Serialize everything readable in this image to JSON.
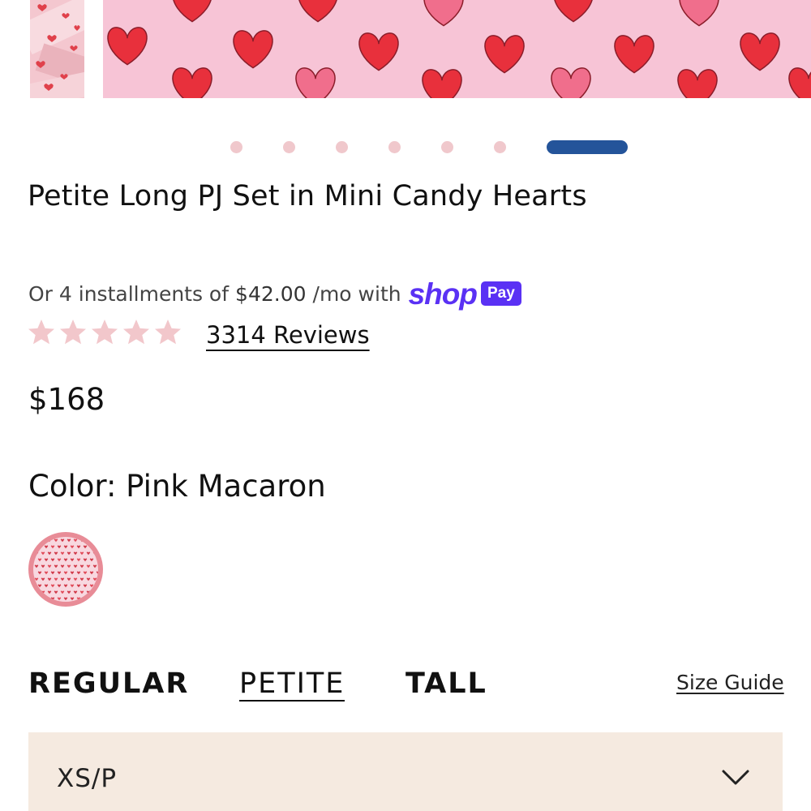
{
  "product": {
    "title": "Petite Long PJ Set in Mini Candy Hearts",
    "price": "$168"
  },
  "carousel": {
    "dot_count": 7,
    "active_index": 6
  },
  "financing": {
    "prefix": "Or 4 installments of",
    "amount": "$42.00",
    "suffix": "/mo with",
    "brand_word": "shop",
    "brand_badge": "Pay",
    "brand_color": "#5a31f4"
  },
  "rating": {
    "stars": 5,
    "star_color": "#f2c7cb",
    "reviews_label": "3314 Reviews"
  },
  "color": {
    "label": "Color: Pink Macaron",
    "swatch_icon": "pink-hearts-swatch"
  },
  "fit_tabs": {
    "items": [
      "REGULAR",
      "PETITE",
      "TALL"
    ],
    "selected": "PETITE",
    "size_guide_label": "Size Guide"
  },
  "size": {
    "selected_value": "XS/P",
    "icon": "chevron-down-icon"
  },
  "colors": {
    "accent_dot": "#24549a",
    "inactive_dot": "#f0c8cc",
    "size_bg": "#f5eae0",
    "image_bg": "#f7c4d6",
    "heart_red": "#e8303c",
    "heart_pink": "#f06e8c"
  }
}
